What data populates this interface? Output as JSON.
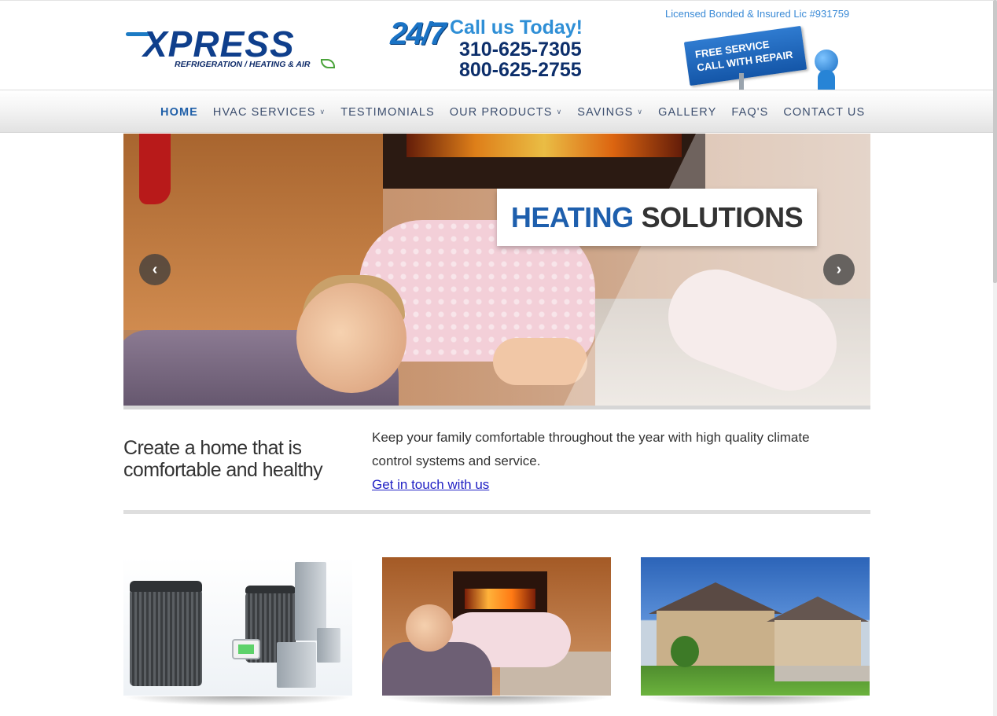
{
  "header": {
    "logo_text": "XPRESS",
    "logo_subtitle": "REFRIGERATION / HEATING & AIR",
    "badge_247": "24/7",
    "call_heading": "Call us Today!",
    "phone_primary": "310-625-7305",
    "phone_secondary": "800-625-2755",
    "license_text": "Licensed Bonded & Insured Lic #931759",
    "promo_line1": "FREE SERVICE",
    "promo_line2": "CALL WITH REPAIR"
  },
  "nav": {
    "items": [
      {
        "label": "HOME",
        "active": true,
        "has_dropdown": false
      },
      {
        "label": "HVAC SERVICES",
        "active": false,
        "has_dropdown": true
      },
      {
        "label": "TESTIMONIALS",
        "active": false,
        "has_dropdown": false
      },
      {
        "label": "OUR PRODUCTS",
        "active": false,
        "has_dropdown": true
      },
      {
        "label": "SAVINGS",
        "active": false,
        "has_dropdown": true
      },
      {
        "label": "GALLERY",
        "active": false,
        "has_dropdown": false
      },
      {
        "label": "FAQ'S",
        "active": false,
        "has_dropdown": false
      },
      {
        "label": "CONTACT US",
        "active": false,
        "has_dropdown": false
      }
    ],
    "dropdown_icon": "double-chevron-down-icon"
  },
  "hero": {
    "title_word1": "HEATING",
    "title_word2": "SOLUTIONS",
    "prev_icon": "chevron-left-icon",
    "next_icon": "chevron-right-icon"
  },
  "intro": {
    "heading": "Create a home that is comfortable and healthy",
    "body": "Keep your family comfortable throughout the year with high quality climate control systems and service.",
    "link_label": "Get in touch with us"
  },
  "colors": {
    "brand_blue": "#1f5fa8",
    "nav_text": "#3d4f6f",
    "link": "#2121c4",
    "heading_text": "#333333"
  }
}
